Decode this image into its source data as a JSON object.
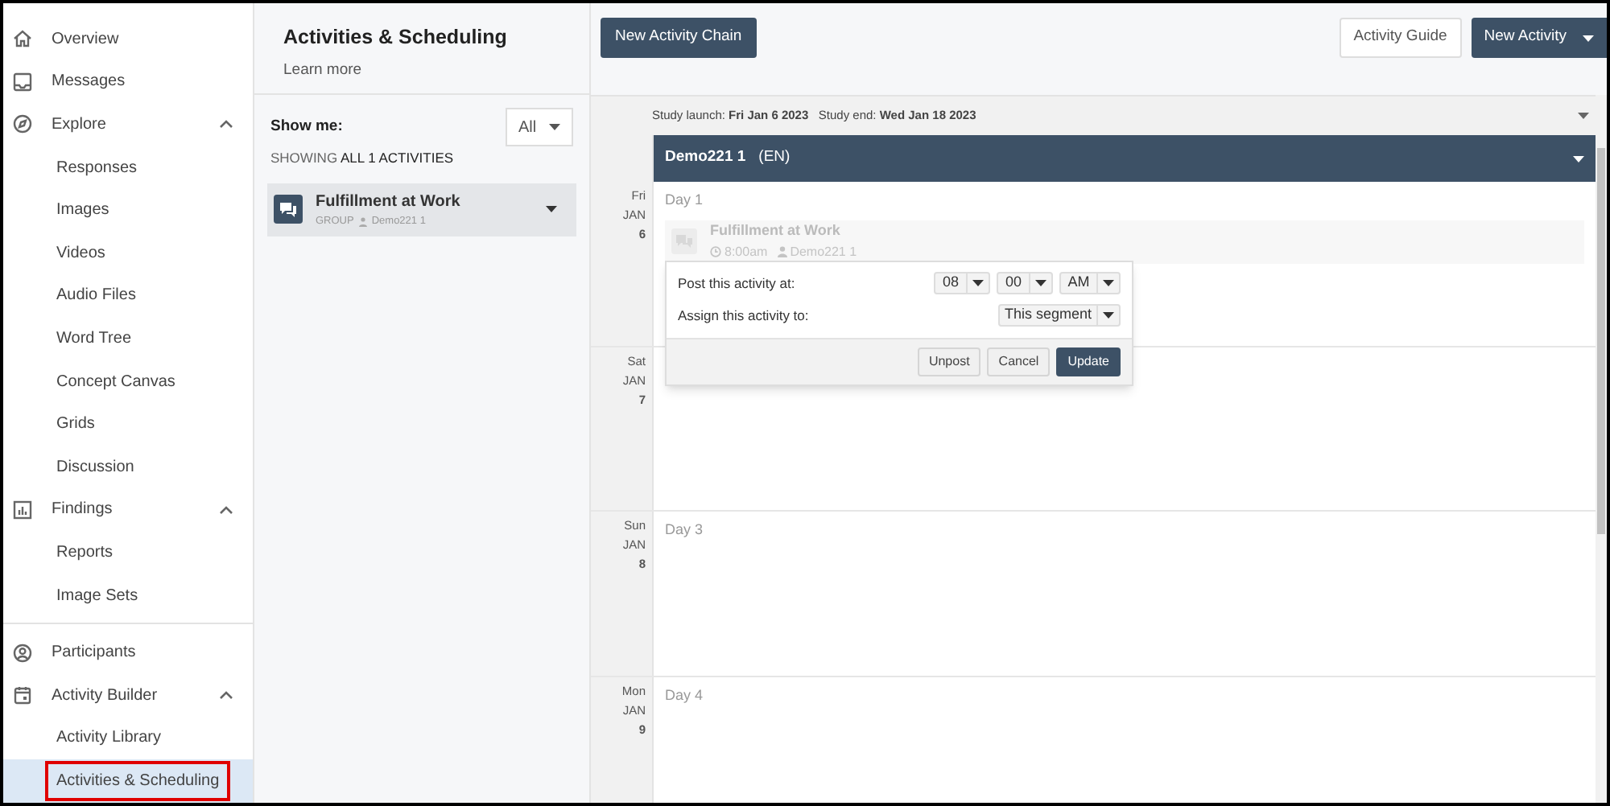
{
  "sidebar": {
    "items": [
      {
        "label": "Overview"
      },
      {
        "label": "Messages"
      },
      {
        "label": "Explore",
        "expanded": true,
        "children": [
          {
            "label": "Responses",
            "selected": false,
            "highlighted": false
          },
          {
            "label": "Images",
            "selected": false,
            "highlighted": false
          },
          {
            "label": "Videos",
            "selected": false,
            "highlighted": false
          },
          {
            "label": "Audio Files",
            "selected": false,
            "highlighted": false
          },
          {
            "label": "Word Tree",
            "selected": false,
            "highlighted": false
          },
          {
            "label": "Concept Canvas",
            "selected": false,
            "highlighted": false
          },
          {
            "label": "Grids",
            "selected": false,
            "highlighted": false
          },
          {
            "label": "Discussion",
            "selected": false,
            "highlighted": false
          }
        ]
      },
      {
        "label": "Findings",
        "expanded": true,
        "children": [
          {
            "label": "Reports",
            "selected": false,
            "highlighted": false
          },
          {
            "label": "Image Sets",
            "selected": false,
            "highlighted": false
          }
        ]
      },
      {
        "label": "Participants"
      },
      {
        "label": "Activity Builder",
        "expanded": true,
        "children": [
          {
            "label": "Activity Library",
            "selected": false,
            "highlighted": false
          },
          {
            "label": "Activities & Scheduling",
            "selected": true,
            "highlighted": true
          }
        ]
      }
    ]
  },
  "panel": {
    "title": "Activities & Scheduling",
    "link": "Learn more",
    "filter_label": "Show me:",
    "filter_value": "All",
    "showing": "SHOWING **ALL 1 ACTIVITIES**",
    "activities": [
      {
        "title": "Fulfillment at Work",
        "type": "GROUP",
        "segment": "Demo221 1"
      }
    ]
  },
  "toolbar": {
    "left_button": "New Activity Chain",
    "guide_button": "Activity Guide",
    "new_button": "New Activity"
  },
  "study_bar": "Study launch: **Fri Jan 6 2023**   Study end: **Wed Jan 18 2023**",
  "segment": {
    "name": "Demo221 1",
    "lang": "(EN)"
  },
  "days": [
    {
      "weekday": "Fri",
      "month": "JAN",
      "date": "6",
      "label": "Day 1",
      "events": [
        {
          "title": "Fulfillment at Work",
          "time": "8:00am",
          "segment": "Demo221 1"
        }
      ]
    },
    {
      "weekday": "Sat",
      "month": "JAN",
      "date": "7"
    },
    {
      "weekday": "Sun",
      "month": "JAN",
      "date": "8",
      "label": "Day 3"
    },
    {
      "weekday": "Mon",
      "month": "JAN",
      "date": "9",
      "label": "Day 4"
    }
  ],
  "popup": {
    "post_label": "Post this activity at:",
    "hour": "08",
    "minute": "00",
    "ampm": "AM",
    "assign_label": "Assign this activity to:",
    "assign_value": "This segment",
    "buttons": [
      {
        "label": "Unpost",
        "kind": "secondary"
      },
      {
        "label": "Cancel",
        "kind": "secondary"
      },
      {
        "label": "Update",
        "kind": "primary"
      }
    ]
  }
}
